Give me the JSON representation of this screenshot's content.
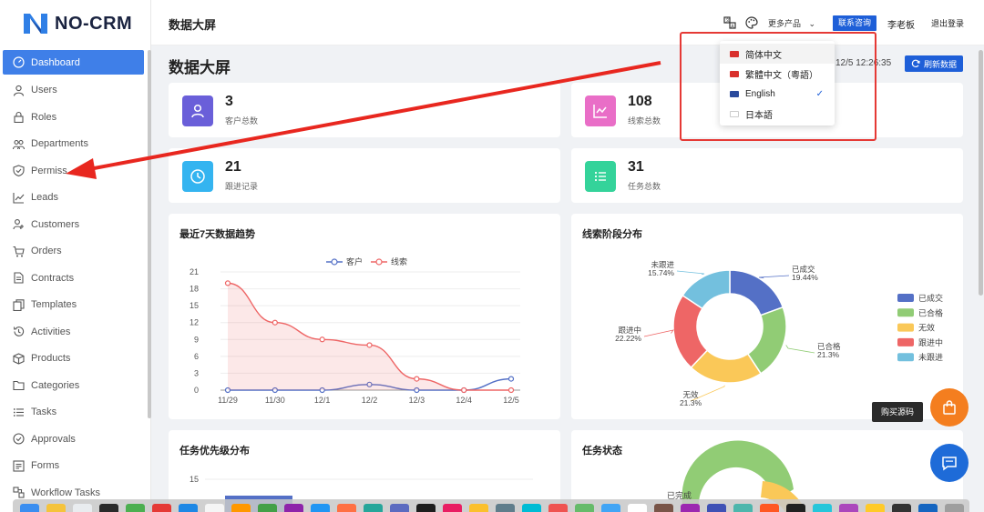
{
  "app": {
    "logo_text": "NO-CRM"
  },
  "sidebar": {
    "items": [
      {
        "label": "Dashboard",
        "icon": "dashboard-icon",
        "active": true
      },
      {
        "label": "Users",
        "icon": "user-icon"
      },
      {
        "label": "Roles",
        "icon": "lock-icon"
      },
      {
        "label": "Departments",
        "icon": "team-icon"
      },
      {
        "label": "Permiss",
        "icon": "shield-icon"
      },
      {
        "label": "Leads",
        "icon": "trend-icon"
      },
      {
        "label": "Customers",
        "icon": "customers-icon"
      },
      {
        "label": "Orders",
        "icon": "cart-icon"
      },
      {
        "label": "Contracts",
        "icon": "contract-icon"
      },
      {
        "label": "Templates",
        "icon": "template-icon"
      },
      {
        "label": "Activities",
        "icon": "history-icon"
      },
      {
        "label": "Products",
        "icon": "box-icon"
      },
      {
        "label": "Categories",
        "icon": "folder-icon"
      },
      {
        "label": "Tasks",
        "icon": "list-icon"
      },
      {
        "label": "Approvals",
        "icon": "check-circle-icon"
      },
      {
        "label": "Forms",
        "icon": "form-icon"
      },
      {
        "label": "Workflow Tasks",
        "icon": "workflow-icon"
      }
    ]
  },
  "header": {
    "title": "数据大屏",
    "more_products": "更多产品",
    "contact": "联系咨询",
    "user": "李老板",
    "logout": "退出登录"
  },
  "main": {
    "page_title": "数据大屏",
    "timestamp": "12/5 12:26:35",
    "refresh": "刷新数据",
    "stats": [
      {
        "value": "3",
        "label": "客户总数",
        "color": "#6a5fd9"
      },
      {
        "value": "108",
        "label": "线索总数",
        "color": "#e96ec7"
      },
      {
        "value": "21",
        "label": "跟进记录",
        "color": "#34b4f0"
      },
      {
        "value": "31",
        "label": "任务总数",
        "color": "#34d39a"
      }
    ]
  },
  "language_menu": {
    "items": [
      {
        "label": "简体中文",
        "flag_color": "#d9302c",
        "highlighted": true
      },
      {
        "label": "繁體中文（粵語）",
        "flag_color": "#d9302c"
      },
      {
        "label": "English",
        "flag_color": "#2a4a9c",
        "selected": true
      },
      {
        "label": "日本語",
        "flag_color": "#ffffff"
      }
    ]
  },
  "chart_data": [
    {
      "type": "line",
      "title": "最近7天数据趋势",
      "x": [
        "11/29",
        "11/30",
        "12/1",
        "12/2",
        "12/3",
        "12/4",
        "12/5"
      ],
      "y_ticks": [
        0,
        3,
        6,
        9,
        12,
        15,
        18,
        21
      ],
      "ylim": [
        0,
        21
      ],
      "legend_position": "top-center",
      "series": [
        {
          "name": "客户",
          "values": [
            0,
            0,
            0,
            1,
            0,
            0,
            2
          ],
          "color": "#5470c6"
        },
        {
          "name": "线索",
          "values": [
            19,
            12,
            9,
            8,
            2,
            0,
            0
          ],
          "color": "#ee6666"
        }
      ]
    },
    {
      "type": "pie",
      "title": "线索阶段分布",
      "legend_position": "right",
      "slices": [
        {
          "name": "已成交",
          "value": 19.44,
          "label": "19.44%",
          "color": "#5470c6"
        },
        {
          "name": "已合格",
          "value": 21.3,
          "label": "21.3%",
          "color": "#91cc75"
        },
        {
          "name": "无效",
          "value": 21.3,
          "label": "21.3%",
          "color": "#fac858"
        },
        {
          "name": "跟进中",
          "value": 22.22,
          "label": "22.22%",
          "color": "#ee6666"
        },
        {
          "name": "未跟进",
          "value": 15.74,
          "label": "15.74%",
          "color": "#73c0de"
        }
      ]
    },
    {
      "type": "bar",
      "title": "任务优先级分布",
      "y_ticks": [
        15
      ]
    },
    {
      "type": "pie",
      "title": "任务状态",
      "labels": [
        "已完成"
      ]
    }
  ],
  "floating": {
    "tooltip": "购买源码"
  }
}
